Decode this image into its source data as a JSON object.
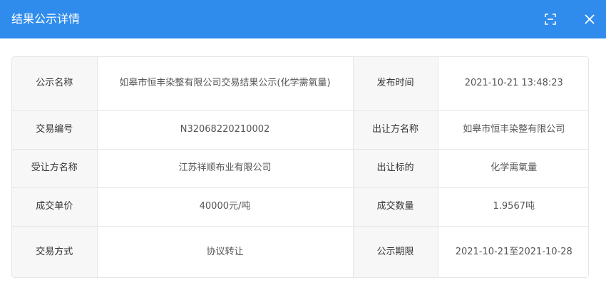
{
  "header": {
    "title": "结果公示详情",
    "fullscreen_icon": "fullscreen-icon",
    "close_icon": "close-icon",
    "bg_color": "#2f8cec"
  },
  "rows": [
    {
      "l1": "公示名称",
      "v1": "如皋市恒丰染整有限公司交易结果公示(化学需氧量)",
      "l2": "发布时间",
      "v2": "2021-10-21 13:48:23"
    },
    {
      "l1": "交易编号",
      "v1": "N32068220210002",
      "l2": "出让方名称",
      "v2": "如皋市恒丰染整有限公司"
    },
    {
      "l1": "受让方名称",
      "v1": "江苏祥顺布业有限公司",
      "l2": "出让标的",
      "v2": "化学需氧量"
    },
    {
      "l1": "成交单价",
      "v1": "40000元/吨",
      "l2": "成交数量",
      "v2": "1.9567吨"
    },
    {
      "l1": "交易方式",
      "v1": "协议转让",
      "l2": "公示期限",
      "v2": "2021-10-21至2021-10-28"
    }
  ]
}
